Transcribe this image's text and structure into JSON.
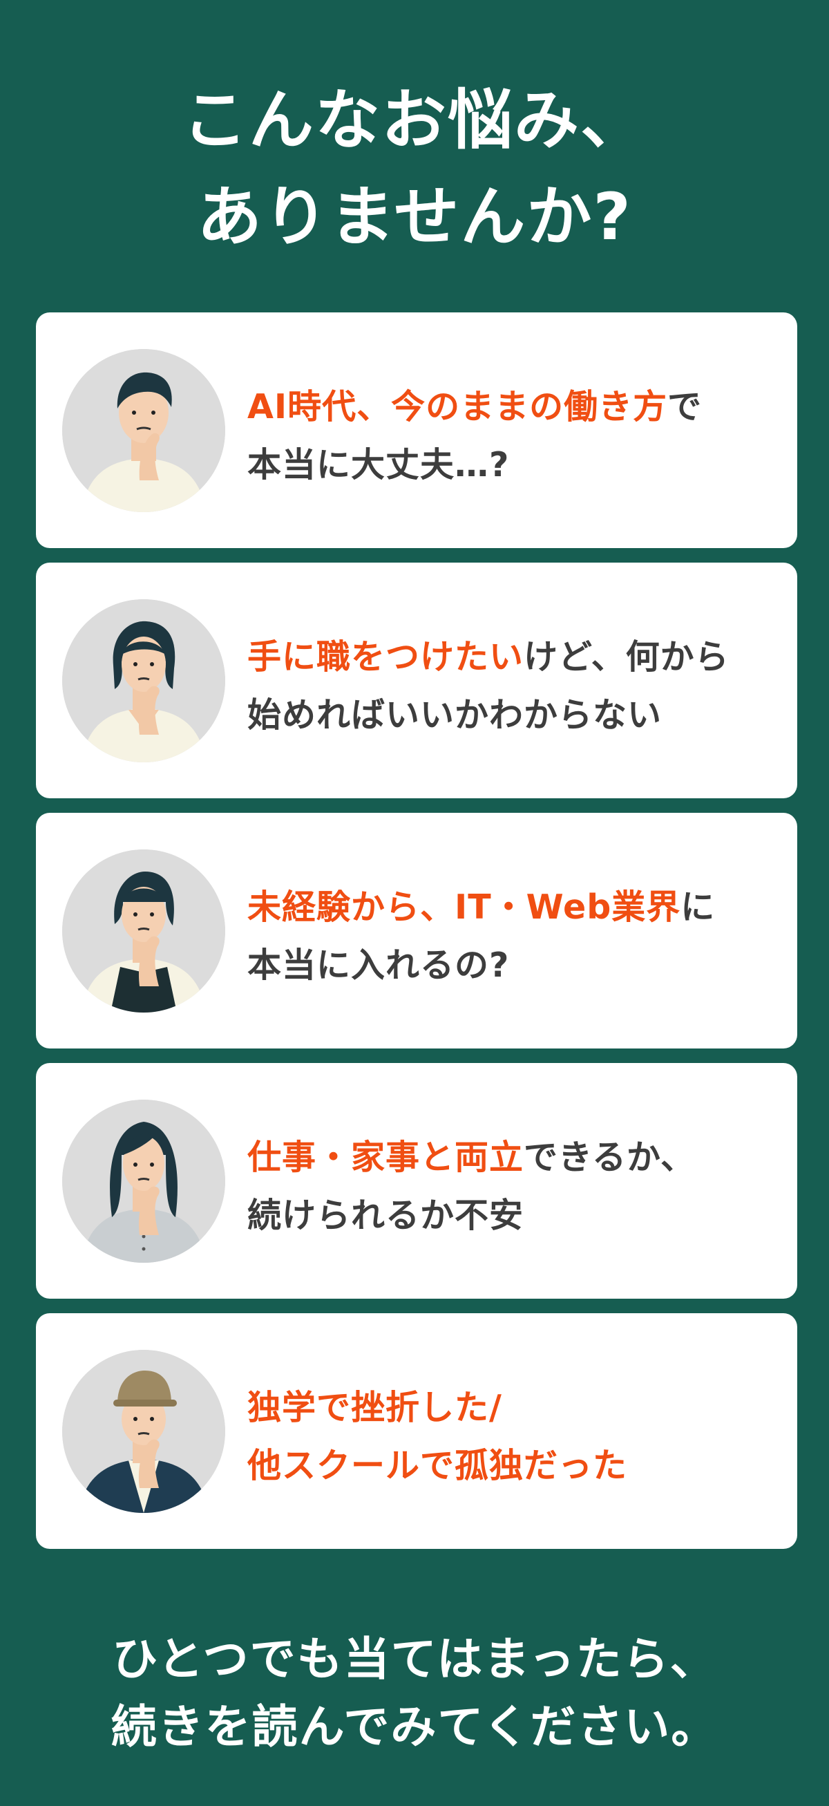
{
  "heading": {
    "line1": "こんなお悩み、",
    "line2": "ありませんか?"
  },
  "cards": [
    {
      "avatar_icon": "man-thinking-icon",
      "line1_highlight": "AI時代、今のままの働き方",
      "line1_rest": "で",
      "line2_highlight": "",
      "line2_rest": "本当に大丈夫…?"
    },
    {
      "avatar_icon": "woman-short-hair-thinking-icon",
      "line1_highlight": "手に職をつけたい",
      "line1_rest": "けど、何から",
      "line2_highlight": "",
      "line2_rest": "始めればいいかわからない"
    },
    {
      "avatar_icon": "woman-bob-hair-thinking-icon",
      "line1_highlight": "未経験から、IT・Web業界",
      "line1_rest": "に",
      "line2_highlight": "",
      "line2_rest": "本当に入れるの?"
    },
    {
      "avatar_icon": "woman-long-hair-thinking-icon",
      "line1_highlight": "仕事・家事と両立",
      "line1_rest": "できるか、",
      "line2_highlight": "",
      "line2_rest": "続けられるか不安"
    },
    {
      "avatar_icon": "man-cap-thinking-icon",
      "line1_highlight": "独学で挫折した/",
      "line1_rest": "",
      "line2_highlight": "他スクールで孤独だった",
      "line2_rest": ""
    }
  ],
  "footer": {
    "line1": "ひとつでも当てはまったら、",
    "line2": "続きを読んでみてください。"
  },
  "colors": {
    "background": "#165d51",
    "card": "#ffffff",
    "highlight": "#f04e12",
    "body_text": "#3d3d3d"
  }
}
